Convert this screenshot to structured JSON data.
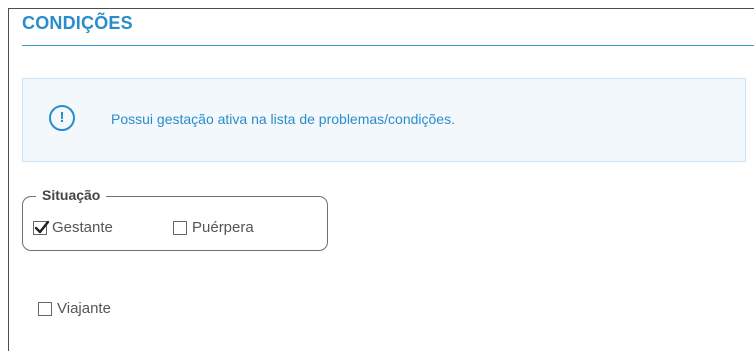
{
  "section": {
    "title": "CONDIÇÕES"
  },
  "alert": {
    "icon": "info-exclamation-icon",
    "text": "Possui gestação ativa na lista de problemas/condições."
  },
  "situacao": {
    "legend": "Situação",
    "options": [
      {
        "label": "Gestante",
        "checked": true
      },
      {
        "label": "Puérpera",
        "checked": false
      }
    ]
  },
  "viajante": {
    "label": "Viajante",
    "checked": false
  },
  "colors": {
    "accent": "#2b8ccc",
    "alert_bg": "#f2f8fc",
    "alert_border": "#c9e3f4"
  }
}
